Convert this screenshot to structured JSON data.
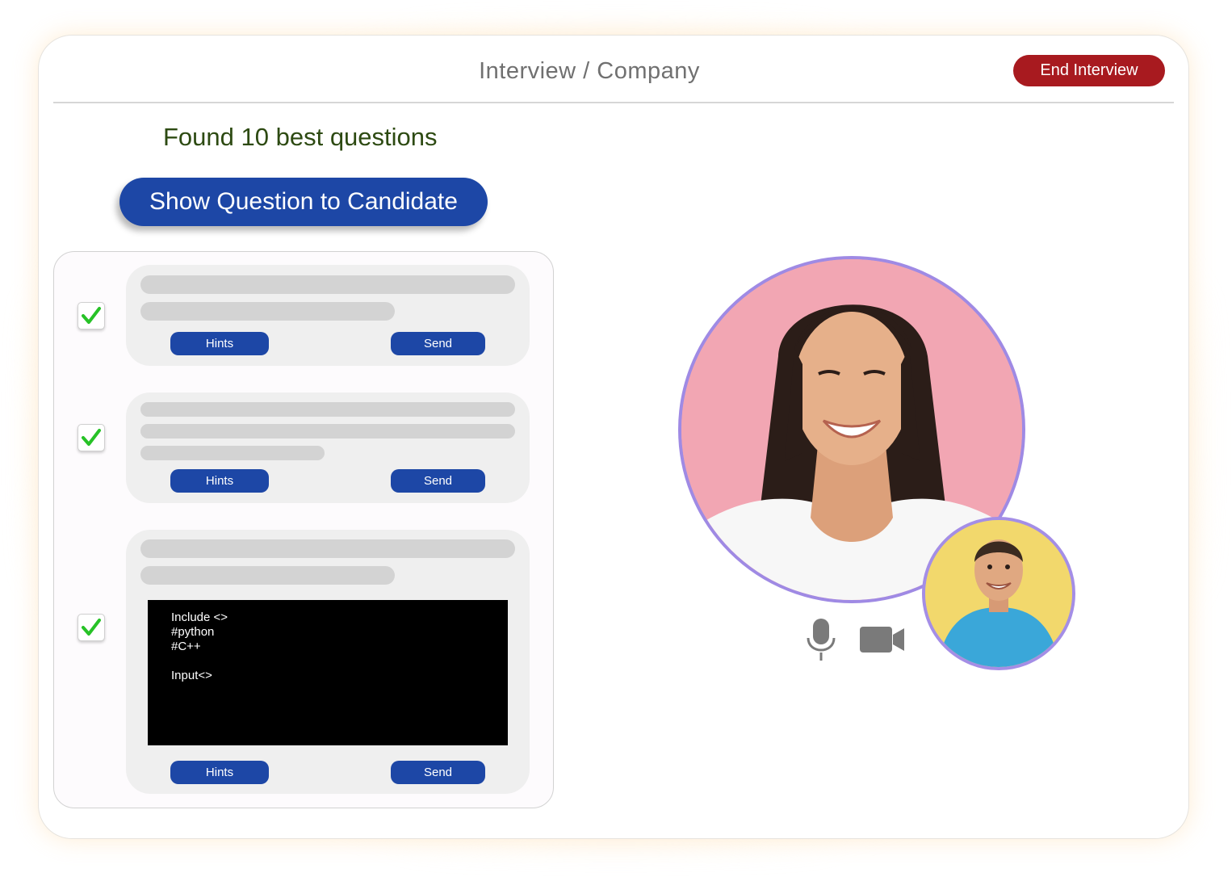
{
  "header": {
    "title": "Interview / Company",
    "end_label": "End Interview"
  },
  "main": {
    "found_text": "Found 10 best questions",
    "show_button_label": "Show Question to Candidate"
  },
  "questions": [
    {
      "checked": true,
      "hints_label": "Hints",
      "send_label": "Send"
    },
    {
      "checked": true,
      "hints_label": "Hints",
      "send_label": "Send"
    },
    {
      "checked": true,
      "hints_label": "Hints",
      "send_label": "Send",
      "code_lines": [
        "Include <>",
        "#python",
        "#C++",
        "Input<>"
      ]
    }
  ],
  "video": {
    "main_participant_icon": "candidate-video",
    "self_participant_icon": "interviewer-video",
    "controls": [
      "microphone-icon",
      "camera-icon"
    ]
  },
  "colors": {
    "primary": "#1d47a6",
    "danger": "#a81a1f",
    "accent_ring": "#9f8ae4",
    "check": "#27c227",
    "found_text": "#2d4a12"
  }
}
